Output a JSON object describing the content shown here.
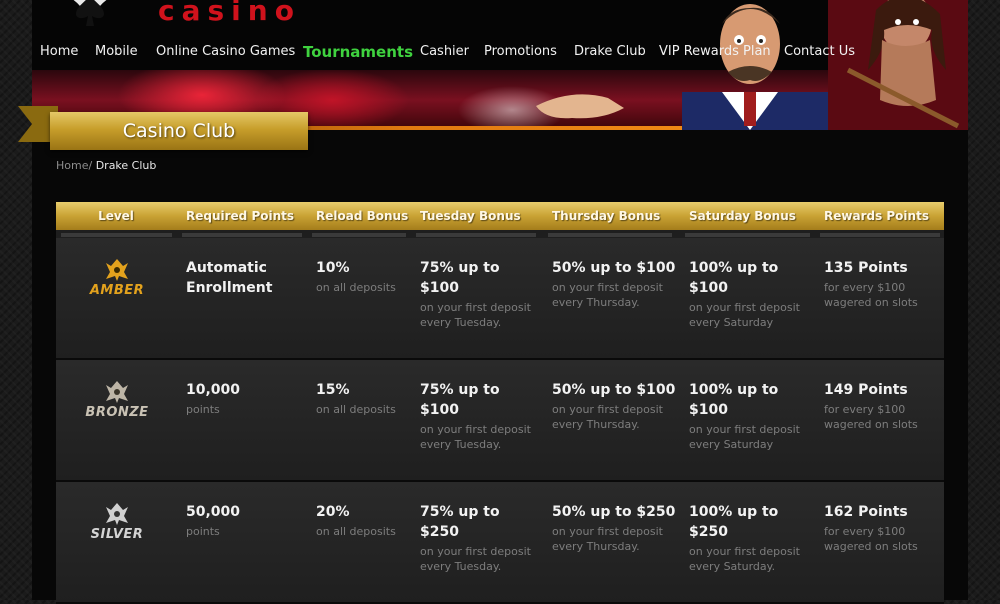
{
  "site": {
    "logo_text": "casino"
  },
  "nav": {
    "items": [
      {
        "label": "Home"
      },
      {
        "label": "Mobile"
      },
      {
        "label": "Online Casino Games"
      },
      {
        "label": "Tournaments"
      },
      {
        "label": "Cashier"
      },
      {
        "label": "Promotions"
      },
      {
        "label": "Drake Club"
      },
      {
        "label": "VIP Rewards Plan"
      },
      {
        "label": "Contact Us"
      }
    ],
    "active_index": 3
  },
  "page": {
    "title": "Casino Club",
    "breadcrumb_home": "Home/",
    "breadcrumb_current": "Drake Club"
  },
  "table": {
    "headers": [
      "Level",
      "Required Points",
      "Reload Bonus",
      "Tuesday Bonus",
      "Thursday Bonus",
      "Saturday Bonus",
      "Rewards Points"
    ],
    "rows": [
      {
        "level": "AMBER",
        "required_main": "Automatic Enrollment",
        "required_sub": "",
        "reload_main": "10%",
        "reload_sub": "on all deposits",
        "tuesday_main": "75% up to $100",
        "tuesday_sub": "on your first deposit every Tuesday.",
        "thursday_main": "50% up to $100",
        "thursday_sub": "on your first deposit every Thursday.",
        "saturday_main": "100% up to $100",
        "saturday_sub": "on your first deposit every Saturday",
        "rewards_main": "135 Points",
        "rewards_sub": "for every $100 wagered on slots"
      },
      {
        "level": "BRONZE",
        "required_main": "10,000",
        "required_sub": "points",
        "reload_main": "15%",
        "reload_sub": "on all deposits",
        "tuesday_main": "75% up to $100",
        "tuesday_sub": "on your first deposit every Tuesday.",
        "thursday_main": "50% up to $100",
        "thursday_sub": "on your first deposit every Thursday.",
        "saturday_main": "100% up to $100",
        "saturday_sub": "on your first deposit every Saturday",
        "rewards_main": "149 Points",
        "rewards_sub": "for every $100 wagered on slots"
      },
      {
        "level": "SILVER",
        "required_main": "50,000",
        "required_sub": "points",
        "reload_main": "20%",
        "reload_sub": "on all deposits",
        "tuesday_main": "75% up to $250",
        "tuesday_sub": "on your first deposit every Tuesday.",
        "thursday_main": "50% up to $250",
        "thursday_sub": "on your first deposit every Thursday.",
        "saturday_main": "100% up to $250",
        "saturday_sub": "on your first deposit every Saturday.",
        "rewards_main": "162 Points",
        "rewards_sub": "for every $100 wagered on slots"
      }
    ]
  },
  "colors": {
    "logo_red": "#d0121c",
    "nav_active_green": "#3fd23f",
    "gold": "#c9a234",
    "amber": "#e3a21d"
  },
  "icons": [
    "spade-logo-icon",
    "drake-club-emblem-icon"
  ]
}
